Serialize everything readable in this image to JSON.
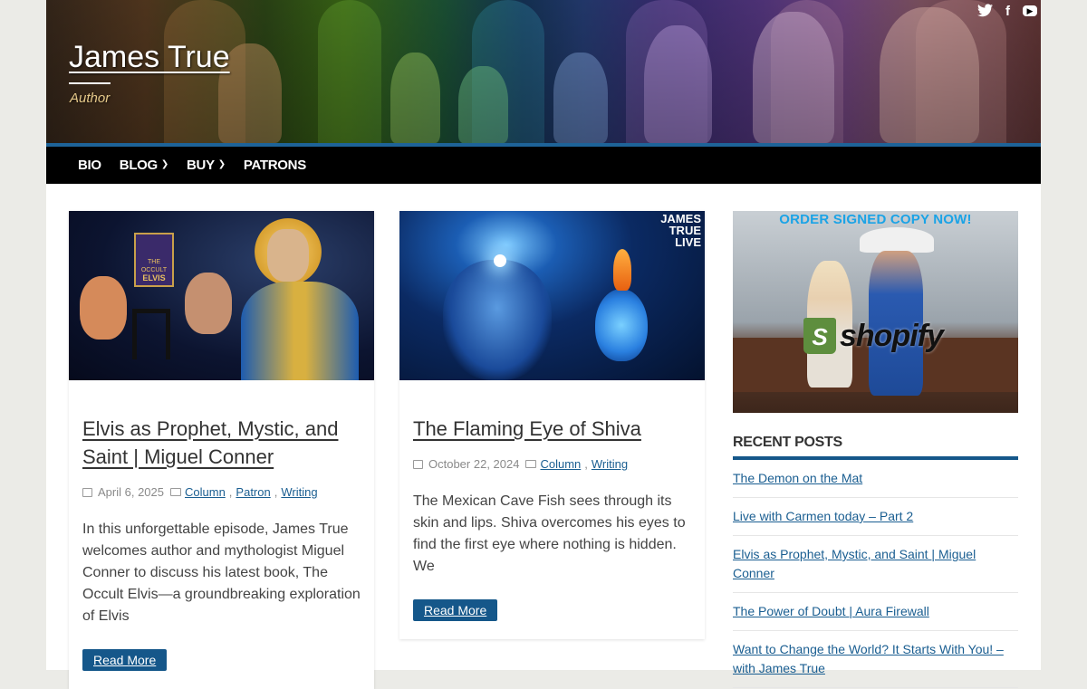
{
  "site": {
    "title": "James True",
    "tagline": "Author"
  },
  "social": [
    "twitter-icon",
    "facebook-icon",
    "youtube-icon"
  ],
  "nav": [
    {
      "label": "BIO",
      "dropdown": false
    },
    {
      "label": "BLOG",
      "dropdown": true
    },
    {
      "label": "BUY",
      "dropdown": true
    },
    {
      "label": "PATRONS",
      "dropdown": false
    }
  ],
  "posts": [
    {
      "title": "Elvis as Prophet, Mystic, and Saint | Miguel Conner",
      "date": "April 6, 2025",
      "categories": [
        "Column",
        "Patron",
        "Writing"
      ],
      "excerpt": "In this unforgettable episode, James True welcomes author and mythologist Miguel Conner to discuss his latest book, The Occult Elvis—a groundbreaking exploration of Elvis",
      "read_more": "Read More",
      "thumb_text": [
        "THE OCCULT",
        "ELVIS"
      ]
    },
    {
      "title": "The Flaming Eye of Shiva",
      "date": "October 22, 2024",
      "categories": [
        "Column",
        "Writing"
      ],
      "excerpt": "The Mexican Cave Fish sees through its skin and lips. Shiva overcomes his eyes to find the first eye where nothing is hidden. We",
      "read_more": "Read More",
      "thumb_text": [
        "JAMES",
        "TRUE",
        "LIVE"
      ]
    }
  ],
  "sidebar": {
    "ad_text": "ORDER SIGNED COPY NOW!",
    "ad_brand": "shopify",
    "recent_title": "RECENT POSTS",
    "recent_posts": [
      "The Demon on the Mat",
      "Live with Carmen today – Part 2",
      "Elvis as Prophet, Mystic, and Saint | Miguel Conner",
      "The Power of Doubt | Aura Firewall",
      "Want to Change the World? It Starts With You! – with James True"
    ]
  },
  "colors": {
    "accent": "#15578a",
    "nav_bg": "#000000",
    "link": "#1a5e91",
    "tagline": "#e6c98a"
  }
}
